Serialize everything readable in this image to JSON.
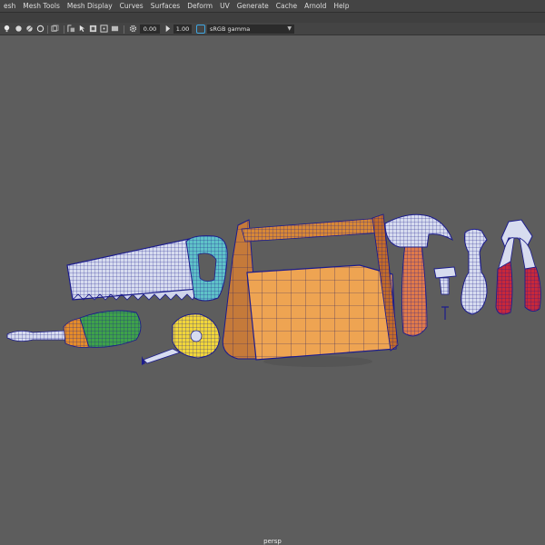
{
  "menu": {
    "items": [
      "esh",
      "Mesh Tools",
      "Mesh Display",
      "Curves",
      "Surfaces",
      "Deform",
      "UV",
      "Generate",
      "Cache",
      "Arnold",
      "Help"
    ]
  },
  "toolbar": {
    "exposure_value": "0.00",
    "gamma_value": "1.00",
    "color_space": "sRGB gamma",
    "icons": [
      "light-icon",
      "paint-icon",
      "paint-select-icon",
      "lasso-icon",
      "snap-icon",
      "xray-icon",
      "isolate-icon",
      "gear-icon"
    ]
  },
  "viewport": {
    "camera_label": "persp",
    "background_color": "#5d5d5d",
    "wire_color": "#1c1c8c",
    "objects": [
      "handsaw",
      "screwdriver",
      "tape-measure",
      "toolbox",
      "hammer",
      "bolt",
      "wrench",
      "pliers"
    ]
  }
}
